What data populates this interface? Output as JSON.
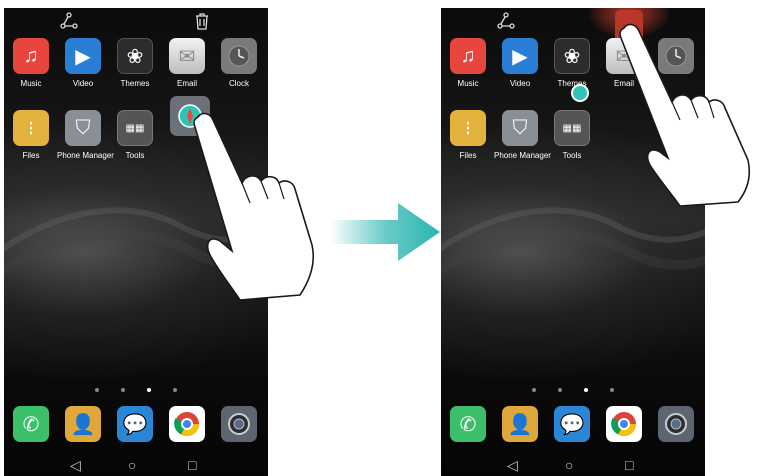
{
  "left_screen": {
    "apps": [
      "Music",
      "Video",
      "Themes",
      "Email",
      "Clock",
      "Files",
      "Phone Manager",
      "Tools"
    ],
    "dock_icons": [
      "phone-icon",
      "contacts-icon",
      "messages-icon",
      "chrome-icon",
      "camera-icon"
    ],
    "page_dots": 4,
    "active_dot": 2
  },
  "right_screen": {
    "apps": [
      "Music",
      "Video",
      "Themes",
      "Email",
      "Files",
      "Phone Manager",
      "Tools"
    ],
    "page_dots": 4,
    "active_dot": 2
  },
  "colors": {
    "music": "#e8453c",
    "video": "#2a7fd4",
    "themes": "#2c2c2c",
    "email": "#d9d9d9",
    "clock": "#7a7a7a",
    "files": "#e3b23c",
    "phone_manager": "#8a8f96",
    "tools": "#555555",
    "phone": "#3bbf6a",
    "contacts": "#e0a83a",
    "messages": "#2b86d6",
    "chrome": "#ffffff",
    "camera": "#5c6570",
    "uninstall_zone": "#c0392b",
    "arrow": "#2bb5b0",
    "drag_dot": "#2ec4b6"
  }
}
